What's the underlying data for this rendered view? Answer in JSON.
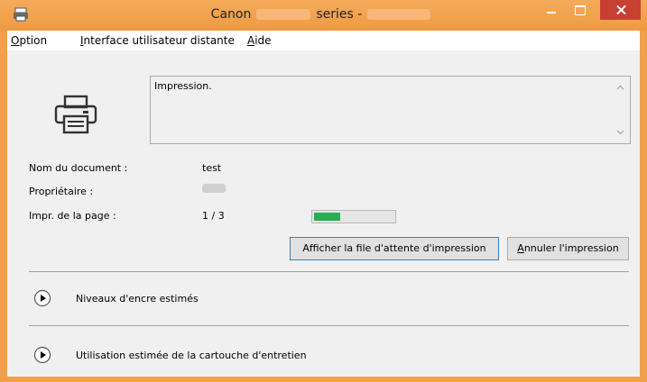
{
  "window": {
    "title_prefix": "Canon",
    "title_suffix": "series -",
    "app_icon": "printer-app-icon",
    "controls": {
      "minimize": "minimize-icon",
      "maximize": "maximize-icon",
      "close": "close-icon"
    }
  },
  "menu": {
    "items": [
      {
        "underline": "O",
        "rest": "ption"
      },
      {
        "underline": "I",
        "rest": "nterface utilisateur distante"
      },
      {
        "underline": "A",
        "rest": "ide"
      }
    ]
  },
  "status": {
    "message": "Impression.",
    "icon": "printer-icon"
  },
  "info": {
    "document_label": "Nom du document :",
    "document_value": "test",
    "owner_label": "Propriétaire :",
    "page_label": "Impr. de la page :",
    "page_value": "1 / 3"
  },
  "progress": {
    "fraction": 0.333,
    "color": "#26b050"
  },
  "buttons": {
    "queue": "Afficher la file d'attente d'impression",
    "cancel_underline": "A",
    "cancel_rest": "nnuler l'impression"
  },
  "sections": {
    "ink": "Niveaux d'encre estimés",
    "maintenance": "Utilisation estimée de la cartouche d'entretien"
  },
  "colors": {
    "titlebar": "#f0a04b",
    "close": "#c84031"
  }
}
